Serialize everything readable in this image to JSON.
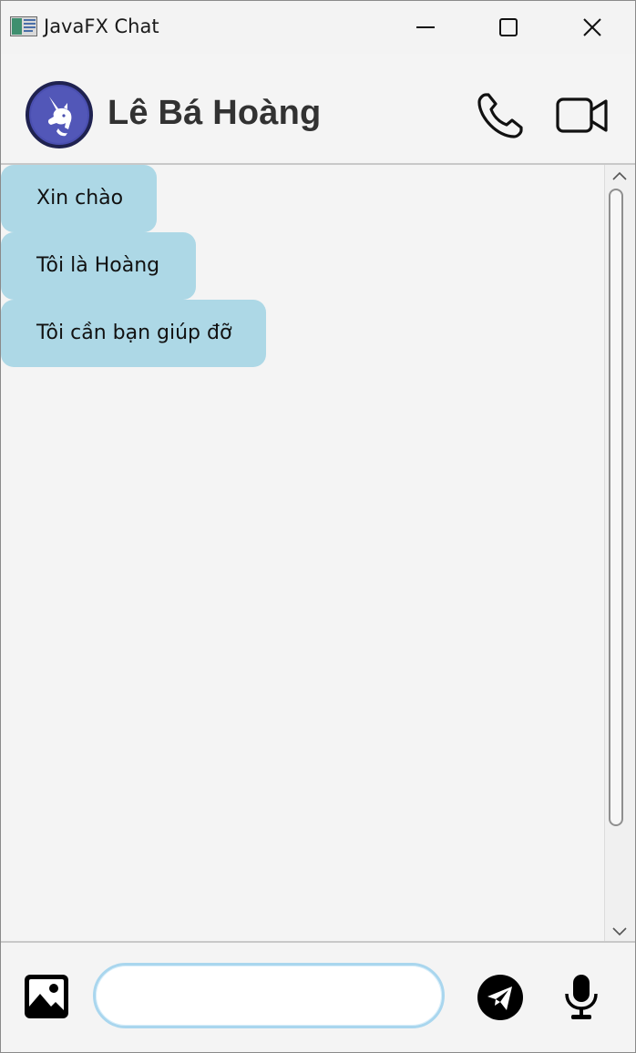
{
  "window": {
    "title": "JavaFX Chat",
    "controls": {
      "minimize_icon": "minimize-icon",
      "maximize_icon": "maximize-icon",
      "close_icon": "close-icon"
    }
  },
  "header": {
    "contact_name": "Lê Bá Hoàng",
    "avatar_icon": "unicorn-avatar-icon",
    "call_icon": "phone-icon",
    "video_icon": "video-camera-icon"
  },
  "messages": [
    {
      "text": "Xin chào"
    },
    {
      "text": "Tôi là Hoàng"
    },
    {
      "text": "Tôi cần bạn giúp đỡ"
    }
  ],
  "composer": {
    "input_value": "",
    "input_placeholder": "",
    "image_icon": "image-icon",
    "send_icon": "send-icon",
    "mic_icon": "microphone-icon"
  },
  "colors": {
    "bubble": "#add8e6",
    "avatar_bg": "#4a4fb0",
    "input_border": "#a9d6ee",
    "text_dark": "#323232"
  }
}
